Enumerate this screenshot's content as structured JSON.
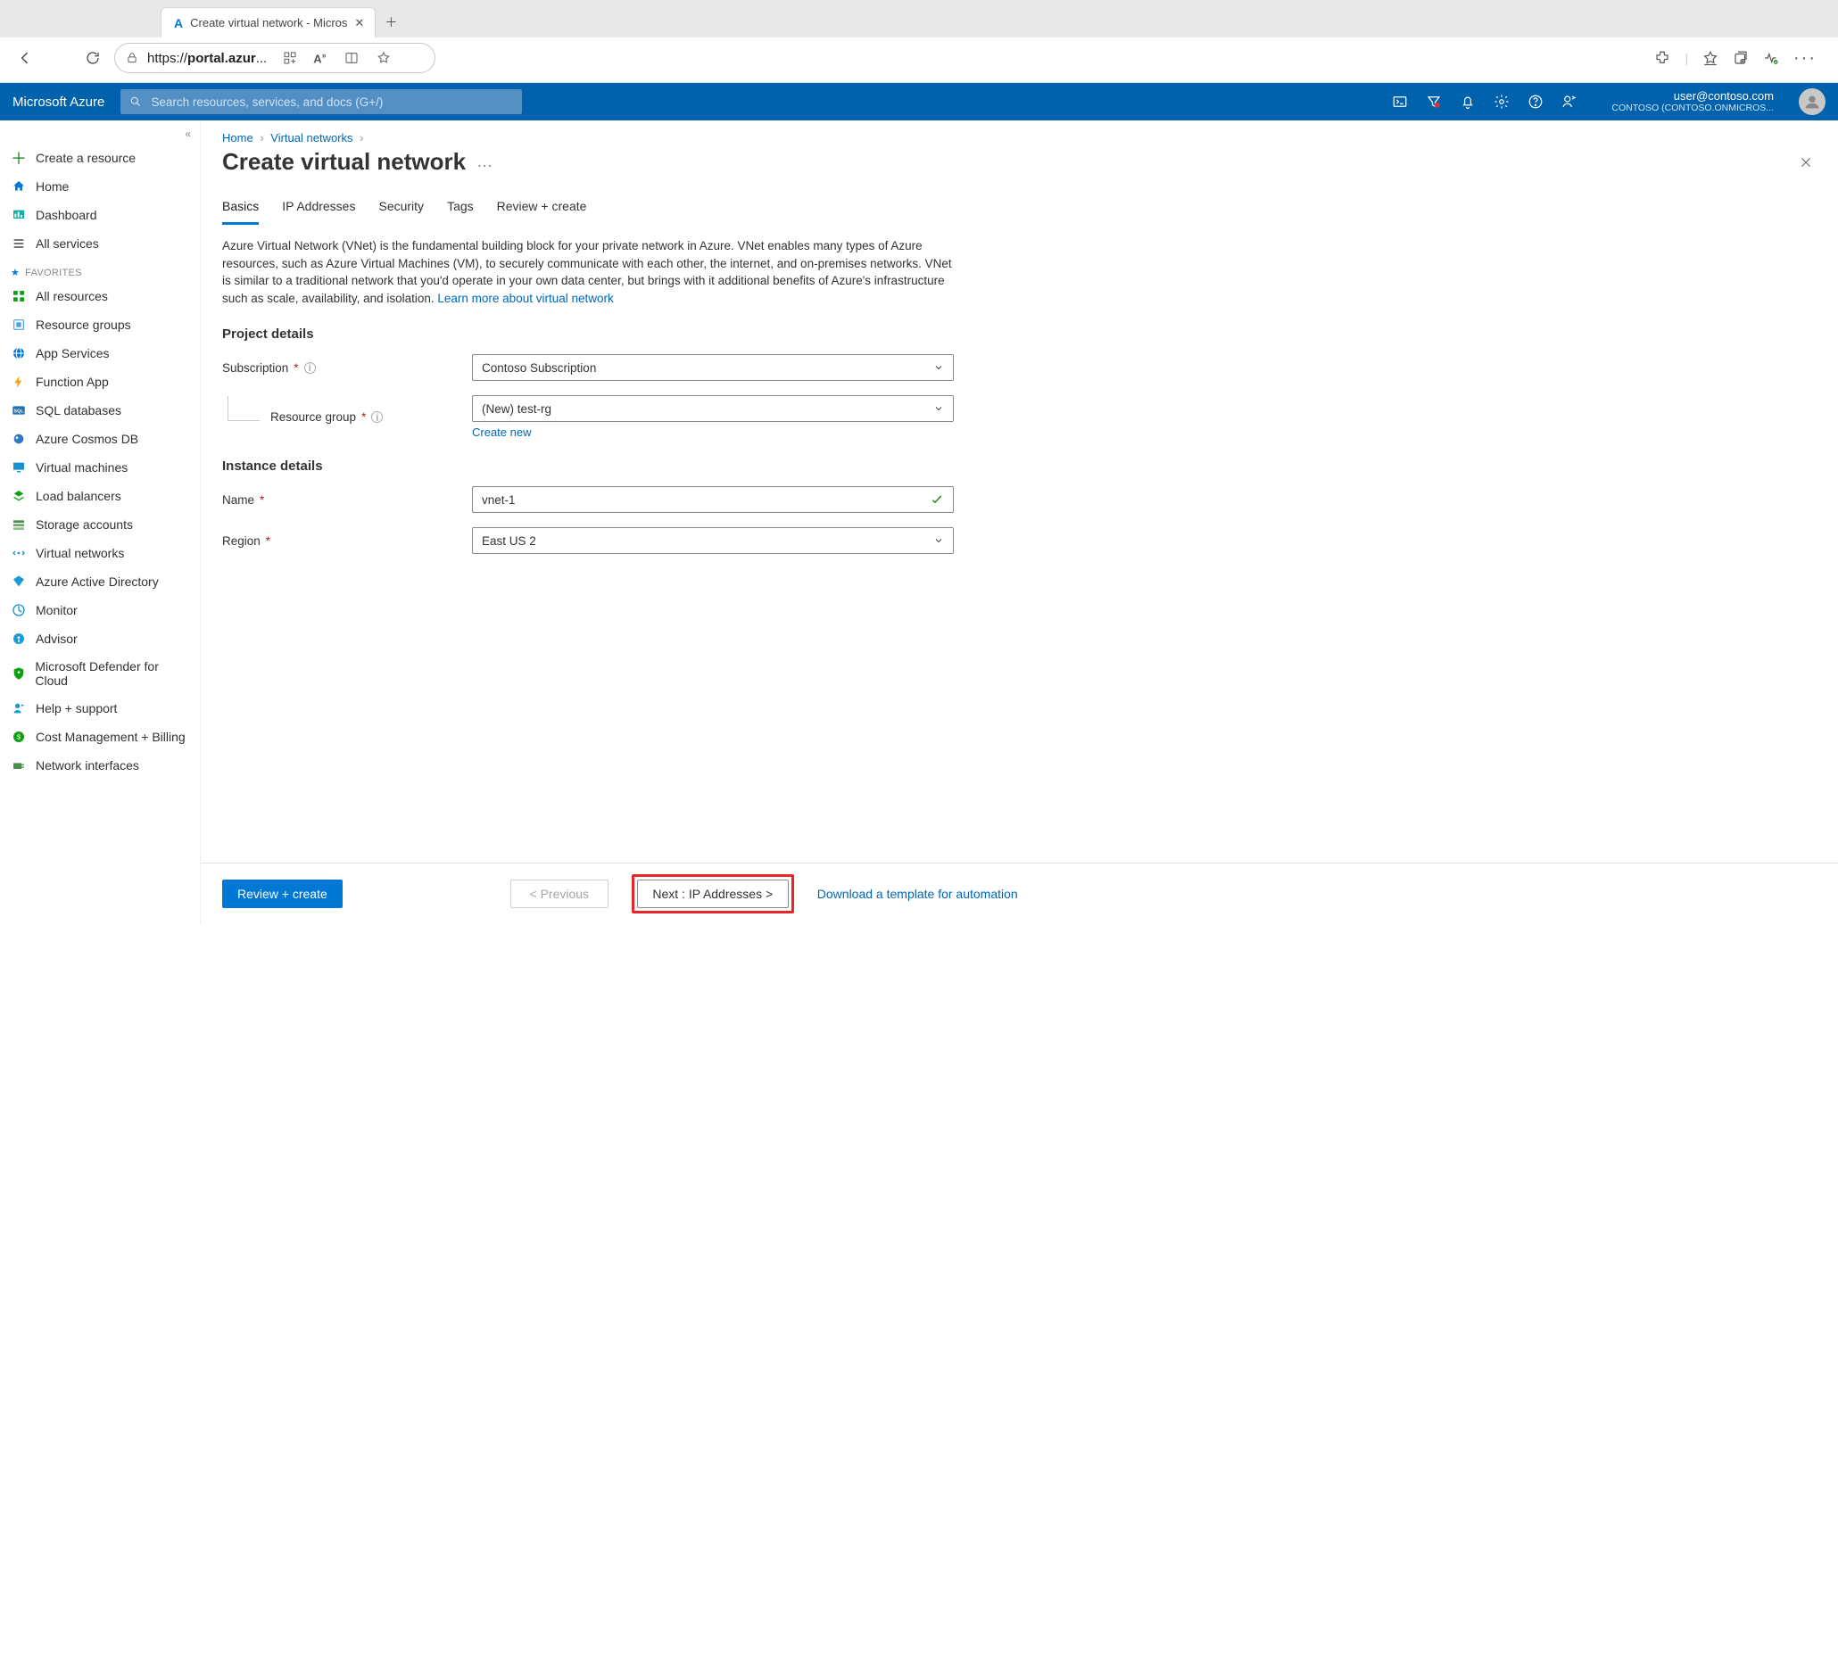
{
  "browser": {
    "tab_title": "Create virtual network - Micros",
    "url_prefix": "https://",
    "url_host": "portal.azur",
    "url_suffix": "..."
  },
  "header": {
    "brand": "Microsoft Azure",
    "search_placeholder": "Search resources, services, and docs (G+/)",
    "account_email": "user@contoso.com",
    "account_directory": "CONTOSO (CONTOSO.ONMICROS..."
  },
  "sidebar": {
    "create": "Create a resource",
    "items_top": [
      {
        "icon": "home",
        "label": "Home",
        "color": "#0078d4"
      },
      {
        "icon": "dash",
        "label": "Dashboard",
        "color": "#0fb3a3"
      },
      {
        "icon": "list",
        "label": "All services",
        "color": "#333"
      }
    ],
    "favorites_label": "FAVORITES",
    "items_fav": [
      {
        "icon": "grid",
        "label": "All resources",
        "color": "#10a110"
      },
      {
        "icon": "rg",
        "label": "Resource groups",
        "color": "#4aa0e6"
      },
      {
        "icon": "globe",
        "label": "App Services",
        "color": "#0078d4"
      },
      {
        "icon": "bolt",
        "label": "Function App",
        "color": "#f0a30a"
      },
      {
        "icon": "sql",
        "label": "SQL databases",
        "color": "#1f6fb2"
      },
      {
        "icon": "cosmos",
        "label": "Azure Cosmos DB",
        "color": "#3079c6"
      },
      {
        "icon": "vm",
        "label": "Virtual machines",
        "color": "#1691d0"
      },
      {
        "icon": "lb",
        "label": "Load balancers",
        "color": "#10a110"
      },
      {
        "icon": "storage",
        "label": "Storage accounts",
        "color": "#4a8f4a"
      },
      {
        "icon": "vnet",
        "label": "Virtual networks",
        "color": "#1c9ad6"
      },
      {
        "icon": "aad",
        "label": "Azure Active Directory",
        "color": "#1c9ad6"
      },
      {
        "icon": "monitor",
        "label": "Monitor",
        "color": "#1691d0"
      },
      {
        "icon": "advisor",
        "label": "Advisor",
        "color": "#1c9ad6"
      },
      {
        "icon": "defender",
        "label": "Microsoft Defender for Cloud",
        "color": "#10a110"
      },
      {
        "icon": "help",
        "label": "Help + support",
        "color": "#1c9ad6"
      },
      {
        "icon": "cost",
        "label": "Cost Management + Billing",
        "color": "#10a110"
      },
      {
        "icon": "nic",
        "label": "Network interfaces",
        "color": "#4a8f4a"
      }
    ]
  },
  "breadcrumb": {
    "home": "Home",
    "item": "Virtual networks"
  },
  "page": {
    "title": "Create virtual network",
    "tabs": [
      "Basics",
      "IP Addresses",
      "Security",
      "Tags",
      "Review + create"
    ],
    "active_tab": 0,
    "intro": "Azure Virtual Network (VNet) is the fundamental building block for your private network in Azure. VNet enables many types of Azure resources, such as Azure Virtual Machines (VM), to securely communicate with each other, the internet, and on-premises networks. VNet is similar to a traditional network that you'd operate in your own data center, but brings with it additional benefits of Azure's infrastructure such as scale, availability, and isolation.   ",
    "intro_link": "Learn more about virtual network"
  },
  "form": {
    "project_heading": "Project details",
    "subscription_label": "Subscription",
    "subscription_value": "Contoso Subscription",
    "rg_label": "Resource group",
    "rg_value": "(New) test-rg",
    "rg_create_new": "Create new",
    "instance_heading": "Instance details",
    "name_label": "Name",
    "name_value": "vnet-1",
    "region_label": "Region",
    "region_value": "East US 2"
  },
  "footer": {
    "review": "Review + create",
    "previous": "< Previous",
    "next": "Next : IP Addresses >",
    "download": "Download a template for automation"
  }
}
